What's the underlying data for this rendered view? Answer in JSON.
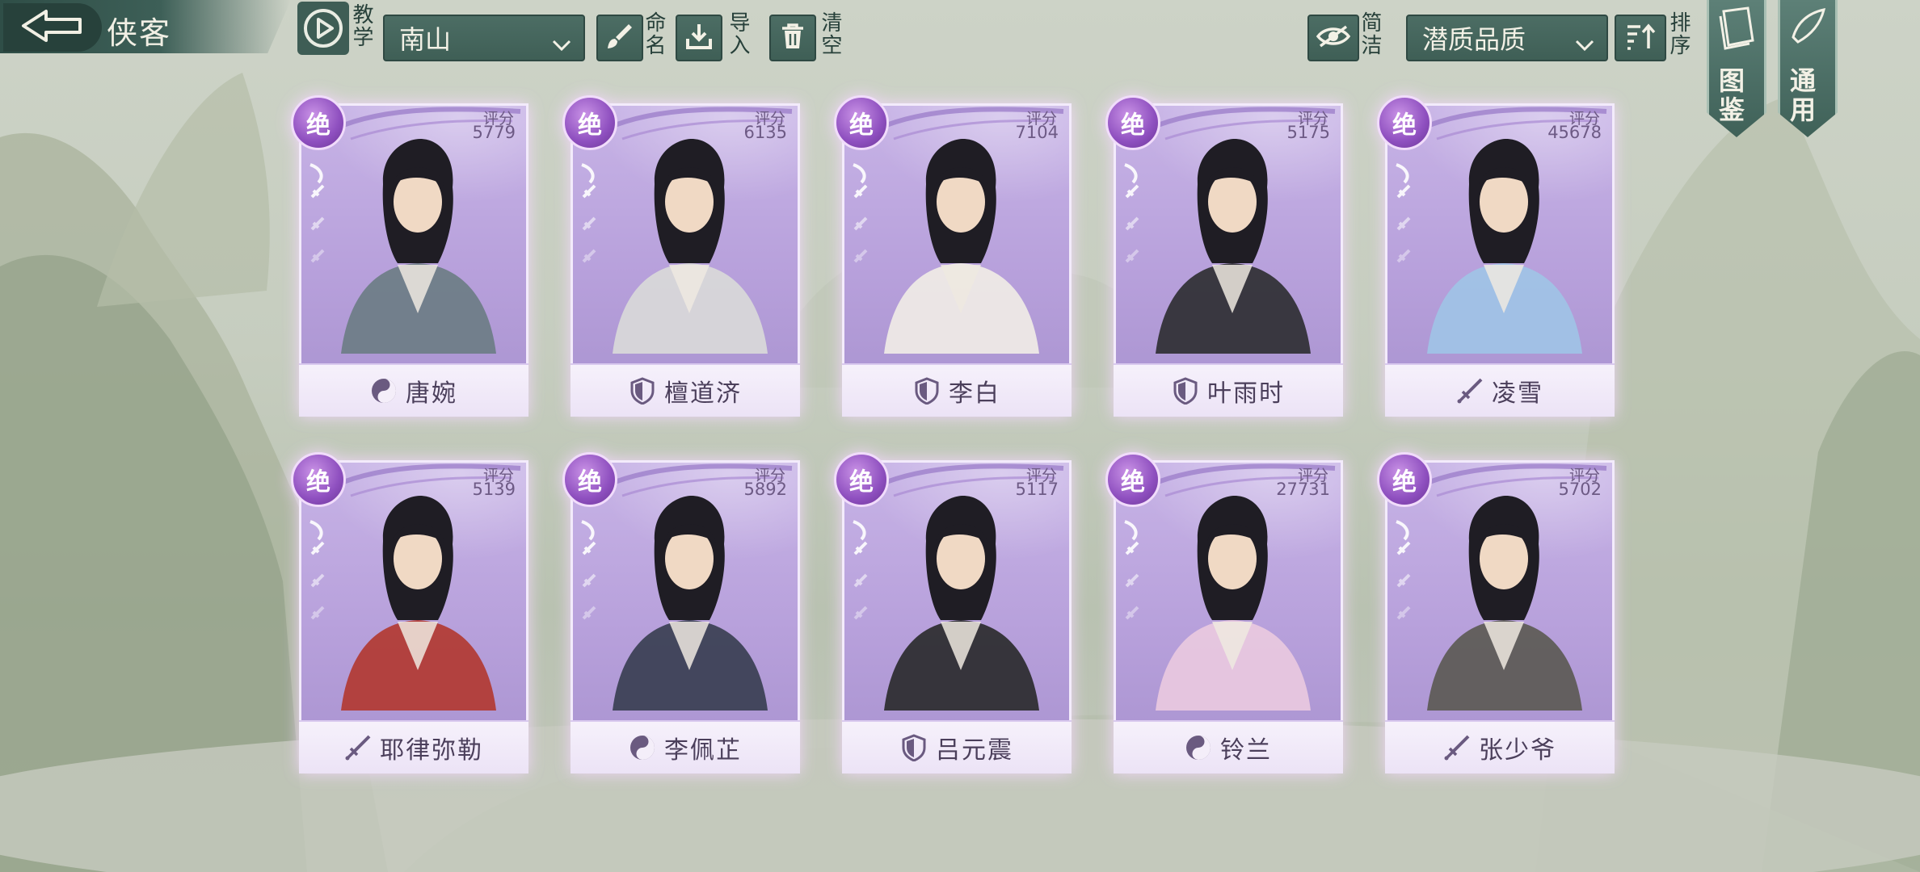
{
  "header": {
    "title": "侠客",
    "tutorial_label": "教学"
  },
  "toolbar": {
    "team_select": "南山",
    "rename_label": "命名",
    "import_label": "导入",
    "clear_label": "清空",
    "simple_label": "简洁",
    "sort_select": "潜质品质",
    "sort_label": "排序"
  },
  "banners": {
    "codex_label": "图鉴",
    "general_label": "通用"
  },
  "score_label": "评分",
  "colors": {
    "accent": "#3f5f56",
    "card": "#b7a0db",
    "grade_badge": "#8e4fbf"
  },
  "heroes": [
    {
      "name": "唐婉",
      "score": "5779",
      "grade": "绝",
      "category": "taiji-icon"
    },
    {
      "name": "檀道济",
      "score": "6135",
      "grade": "绝",
      "category": "shield-icon"
    },
    {
      "name": "李白",
      "score": "7104",
      "grade": "绝",
      "category": "shield-icon"
    },
    {
      "name": "叶雨时",
      "score": "5175",
      "grade": "绝",
      "category": "shield-icon"
    },
    {
      "name": "凌雪",
      "score": "45678",
      "grade": "绝",
      "category": "sword-icon"
    },
    {
      "name": "耶律弥勒",
      "score": "5139",
      "grade": "绝",
      "category": "sword-icon"
    },
    {
      "name": "李佩芷",
      "score": "5892",
      "grade": "绝",
      "category": "taiji-icon"
    },
    {
      "name": "吕元震",
      "score": "5117",
      "grade": "绝",
      "category": "shield-icon"
    },
    {
      "name": "铃兰",
      "score": "27731",
      "grade": "绝",
      "category": "taiji-icon"
    },
    {
      "name": "张少爷",
      "score": "5702",
      "grade": "绝",
      "category": "sword-icon"
    }
  ]
}
